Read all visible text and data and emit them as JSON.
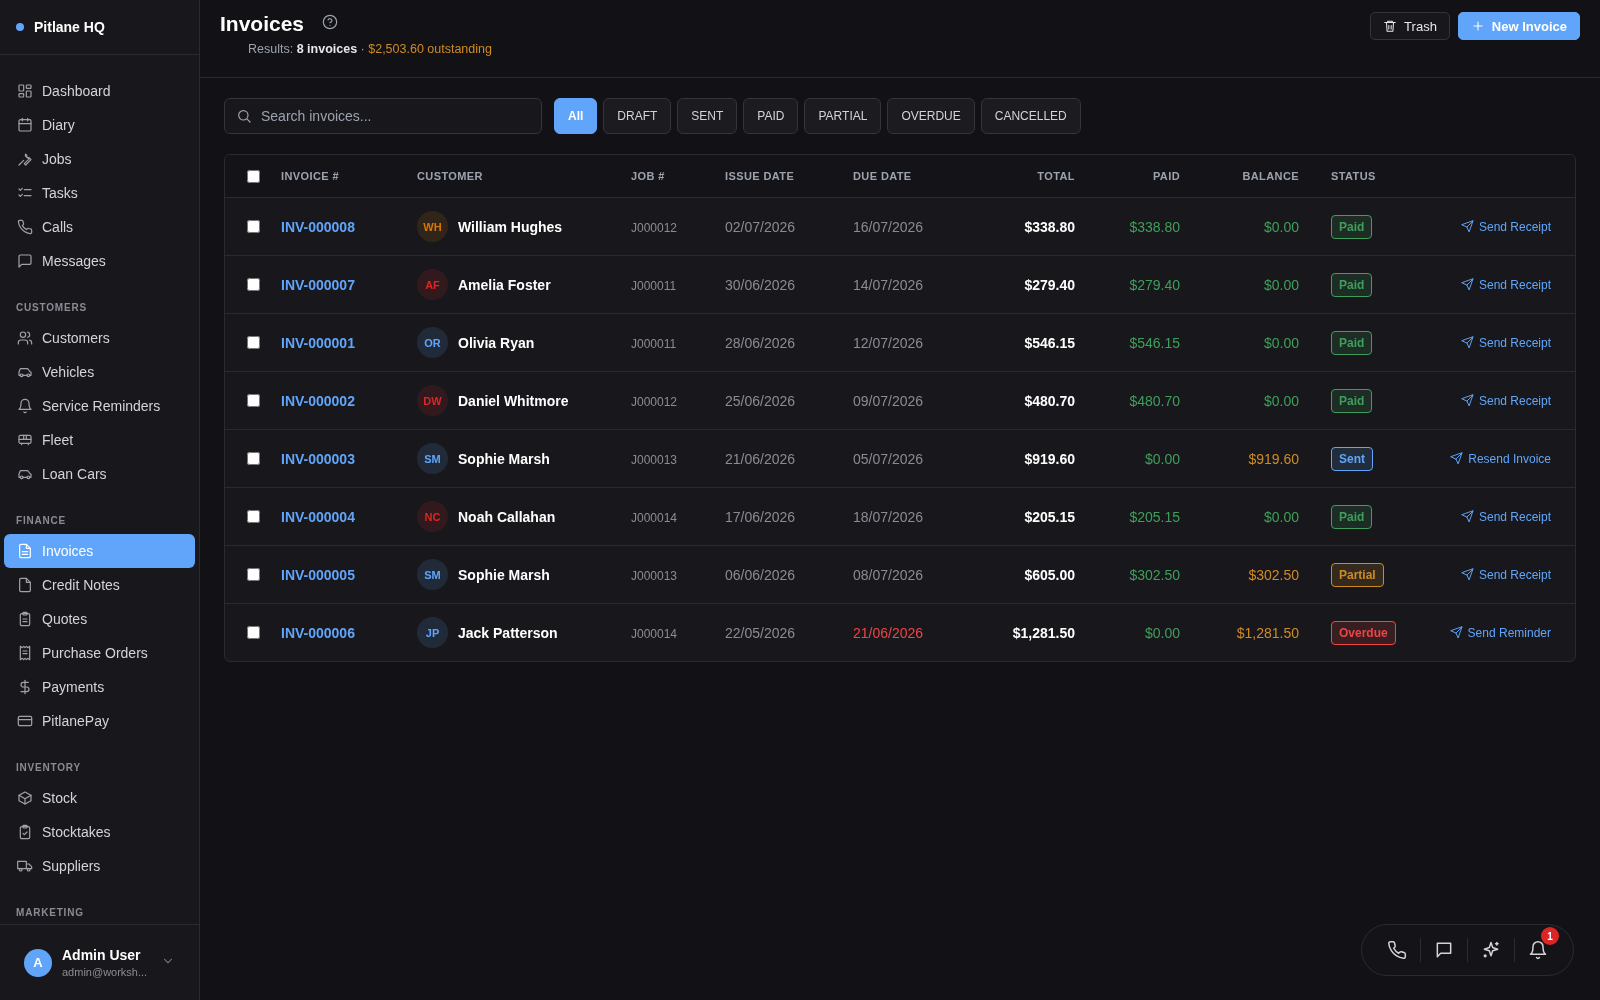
{
  "brand": {
    "name": "Pitlane HQ"
  },
  "sidebar": {
    "sections": [
      {
        "items": [
          {
            "label": "Dashboard",
            "selected": false
          },
          {
            "label": "Diary",
            "selected": false
          },
          {
            "label": "Jobs",
            "selected": false
          },
          {
            "label": "Tasks",
            "selected": false
          },
          {
            "label": "Calls",
            "selected": false
          },
          {
            "label": "Messages",
            "selected": false
          }
        ]
      },
      {
        "title": "CUSTOMERS",
        "items": [
          {
            "label": "Customers",
            "selected": false
          },
          {
            "label": "Vehicles",
            "selected": false
          },
          {
            "label": "Service Reminders",
            "selected": false
          },
          {
            "label": "Fleet",
            "selected": false
          },
          {
            "label": "Loan Cars",
            "selected": false
          }
        ]
      },
      {
        "title": "FINANCE",
        "items": [
          {
            "label": "Invoices",
            "selected": true
          },
          {
            "label": "Credit Notes",
            "selected": false
          },
          {
            "label": "Quotes",
            "selected": false
          },
          {
            "label": "Purchase Orders",
            "selected": false
          },
          {
            "label": "Payments",
            "selected": false
          },
          {
            "label": "PitlanePay",
            "selected": false
          }
        ]
      },
      {
        "title": "INVENTORY",
        "items": [
          {
            "label": "Stock",
            "selected": false
          },
          {
            "label": "Stocktakes",
            "selected": false
          },
          {
            "label": "Suppliers",
            "selected": false
          }
        ]
      },
      {
        "title": "MARKETING"
      }
    ]
  },
  "user": {
    "initial": "A",
    "name": "Admin User",
    "email": "admin@worksh..."
  },
  "header": {
    "title": "Invoices",
    "results_label": "Results:",
    "count": "8 invoices",
    "separator": "·",
    "outstanding": "$2,503.60 outstanding",
    "buttons": [
      {
        "label": "Trash",
        "kind": "secondary"
      },
      {
        "label": "New Invoice",
        "kind": "primary"
      }
    ]
  },
  "search": {
    "placeholder": "Search invoices..."
  },
  "filters": [
    {
      "label": "All",
      "selected": true
    },
    {
      "label": "DRAFT",
      "selected": false
    },
    {
      "label": "SENT",
      "selected": false
    },
    {
      "label": "PAID",
      "selected": false
    },
    {
      "label": "PARTIAL",
      "selected": false
    },
    {
      "label": "OVERDUE",
      "selected": false
    },
    {
      "label": "CANCELLED",
      "selected": false
    }
  ],
  "table": {
    "select_all": false,
    "columns": [
      "INVOICE #",
      "CUSTOMER",
      "JOB #",
      "ISSUE DATE",
      "DUE DATE",
      "TOTAL",
      "PAID",
      "BALANCE",
      "STATUS"
    ],
    "rows": [
      {
        "checked": false,
        "invoice": "INV-000008",
        "initials": "WH",
        "color": "#d97706",
        "customer": "William Hughes",
        "job": "J000012",
        "issue": "02/07/2026",
        "due": "16/07/2026",
        "due_overdue": false,
        "total": "$338.80",
        "paid": "$338.80",
        "balance": "$0.00",
        "balance_outstanding": false,
        "status": {
          "label": "Paid",
          "color": "#3f9e5a"
        },
        "action": "Send Receipt"
      },
      {
        "checked": false,
        "invoice": "INV-000007",
        "initials": "AF",
        "color": "#dc2626",
        "customer": "Amelia Foster",
        "job": "J000011",
        "issue": "30/06/2026",
        "due": "14/07/2026",
        "due_overdue": false,
        "total": "$279.40",
        "paid": "$279.40",
        "balance": "$0.00",
        "balance_outstanding": false,
        "status": {
          "label": "Paid",
          "color": "#3f9e5a"
        },
        "action": "Send Receipt"
      },
      {
        "checked": false,
        "invoice": "INV-000001",
        "initials": "OR",
        "color": "#60a5fa",
        "customer": "Olivia Ryan",
        "job": "J000011",
        "issue": "28/06/2026",
        "due": "12/07/2026",
        "due_overdue": false,
        "total": "$546.15",
        "paid": "$546.15",
        "balance": "$0.00",
        "balance_outstanding": false,
        "status": {
          "label": "Paid",
          "color": "#3f9e5a"
        },
        "action": "Send Receipt"
      },
      {
        "checked": false,
        "invoice": "INV-000002",
        "initials": "DW",
        "color": "#dc2626",
        "customer": "Daniel Whitmore",
        "job": "J000012",
        "issue": "25/06/2026",
        "due": "09/07/2026",
        "due_overdue": false,
        "total": "$480.70",
        "paid": "$480.70",
        "balance": "$0.00",
        "balance_outstanding": false,
        "status": {
          "label": "Paid",
          "color": "#3f9e5a"
        },
        "action": "Send Receipt"
      },
      {
        "checked": false,
        "invoice": "INV-000003",
        "initials": "SM",
        "color": "#60a5fa",
        "customer": "Sophie Marsh",
        "job": "J000013",
        "issue": "21/06/2026",
        "due": "05/07/2026",
        "due_overdue": false,
        "total": "$919.60",
        "paid": "$0.00",
        "balance": "$919.60",
        "balance_outstanding": true,
        "status": {
          "label": "Sent",
          "color": "#60a5fa"
        },
        "action": "Resend Invoice"
      },
      {
        "checked": false,
        "invoice": "INV-000004",
        "initials": "NC",
        "color": "#dc2626",
        "customer": "Noah Callahan",
        "job": "J000014",
        "issue": "17/06/2026",
        "due": "18/07/2026",
        "due_overdue": false,
        "total": "$205.15",
        "paid": "$205.15",
        "balance": "$0.00",
        "balance_outstanding": false,
        "status": {
          "label": "Paid",
          "color": "#3f9e5a"
        },
        "action": "Send Receipt"
      },
      {
        "checked": false,
        "invoice": "INV-000005",
        "initials": "SM",
        "color": "#60a5fa",
        "customer": "Sophie Marsh",
        "job": "J000013",
        "issue": "06/06/2026",
        "due": "08/07/2026",
        "due_overdue": false,
        "total": "$605.00",
        "paid": "$302.50",
        "balance": "$302.50",
        "balance_outstanding": true,
        "status": {
          "label": "Partial",
          "color": "#d08a25"
        },
        "action": "Send Receipt"
      },
      {
        "checked": false,
        "invoice": "INV-000006",
        "initials": "JP",
        "color": "#60a5fa",
        "customer": "Jack Patterson",
        "job": "J000014",
        "issue": "22/05/2026",
        "due": "21/06/2026",
        "due_overdue": true,
        "total": "$1,281.50",
        "paid": "$0.00",
        "balance": "$1,281.50",
        "balance_outstanding": true,
        "status": {
          "label": "Overdue",
          "color": "#ef4444"
        },
        "action": "Send Reminder"
      }
    ]
  },
  "dock": {
    "notification_count": "1"
  }
}
